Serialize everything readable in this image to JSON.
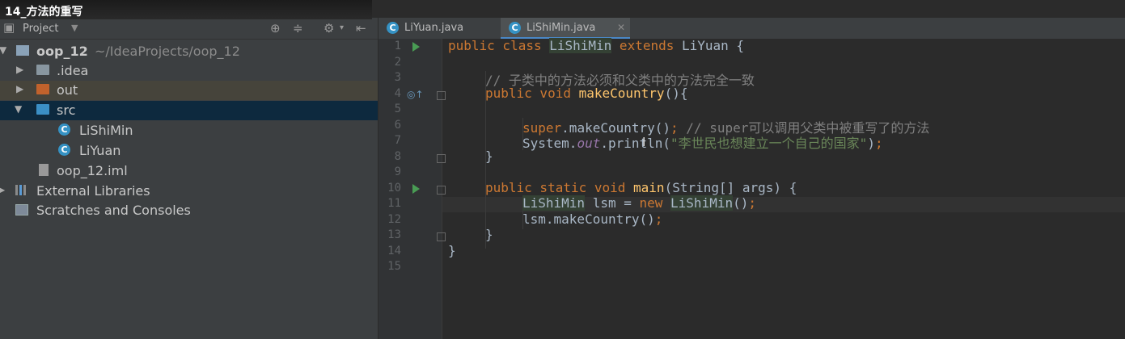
{
  "video_title": "14_方法的重写",
  "project": {
    "panel_label": "Project",
    "tree": [
      {
        "name": "oop_12",
        "hint": "~/IdeaProjects/oop_12"
      },
      {
        "name": ".idea"
      },
      {
        "name": "out"
      },
      {
        "name": "src"
      },
      {
        "name": "LiShiMin"
      },
      {
        "name": "LiYuan"
      },
      {
        "name": "oop_12.iml"
      },
      {
        "name": "External Libraries"
      },
      {
        "name": "Scratches and Consoles"
      }
    ]
  },
  "tabs": [
    {
      "label": "LiYuan.java"
    },
    {
      "label": "LiShiMin.java",
      "active": true
    }
  ],
  "line_numbers": [
    "1",
    "2",
    "3",
    "4",
    "5",
    "6",
    "7",
    "8",
    "9",
    "10",
    "11",
    "12",
    "13",
    "14",
    "15"
  ],
  "code": {
    "l1": {
      "kw1": "public class ",
      "name": "LiShiMin",
      "kw2": " extends ",
      "rest": "LiYuan {"
    },
    "l3": {
      "comment": "// 子类中的方法必须和父类中的方法完全一致"
    },
    "l4": {
      "kw": "public void ",
      "fn": "makeCountry",
      "rest": "(){"
    },
    "l6": {
      "kw": "super",
      "call": ".makeCountry()",
      "semi": ";",
      "comment": " // super可以调用父类中被重写了的方法"
    },
    "l7": {
      "obj": "System.",
      "field": "out",
      "call": ".println(",
      "str": "\"李世民也想建立一个自己的国家\"",
      "end": ")",
      "semi": ";"
    },
    "l8": {
      "text": "}"
    },
    "l10": {
      "kw": "public static void ",
      "fn": "main",
      "rest": "(String[] args) {"
    },
    "l11": {
      "cls": "LiShiMin",
      "mid": " lsm = ",
      "kw": "new ",
      "cls2": "LiShiMin",
      "end": "()",
      "semi": ";"
    },
    "l12": {
      "call": "lsm.makeCountry()",
      "semi": ";"
    },
    "l13": {
      "text": "}"
    },
    "l14": {
      "text": "}"
    }
  },
  "colors": {
    "keyword": "#cc7832",
    "function": "#ffc66d",
    "string": "#6a8759",
    "comment": "#808080",
    "selection": "#0d293e"
  }
}
